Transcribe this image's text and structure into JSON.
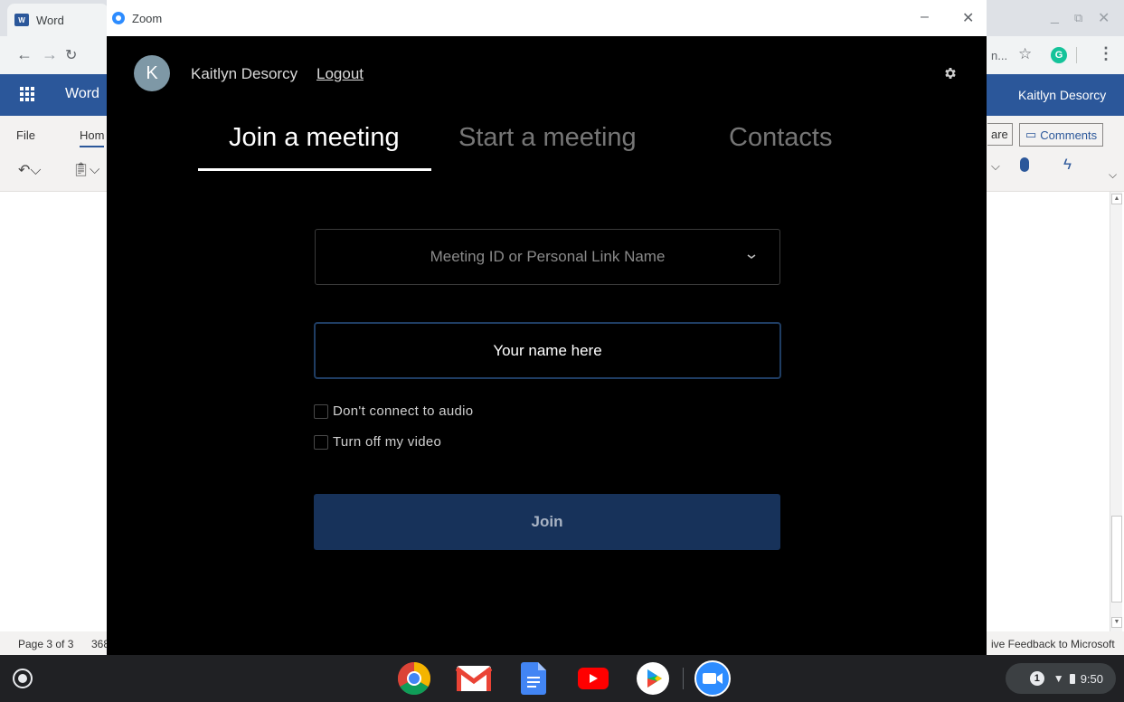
{
  "background_window": {
    "tab_title": "Word",
    "word_app_label": "Word",
    "user_name": "Kaitlyn Desorcy",
    "ribbon_file": "File",
    "ribbon_home": "Hom",
    "share_label": "are",
    "comments_label": "Comments",
    "omnibox_partial": "n...",
    "status_page": "Page 3 of 3",
    "status_words": "368",
    "status_feedback": "ive Feedback to Microsoft"
  },
  "zoom": {
    "window_title": "Zoom",
    "avatar_initial": "K",
    "user_name": "Kaitlyn Desorcy",
    "logout_label": "Logout",
    "tabs": [
      {
        "label": "Join a meeting",
        "active": true
      },
      {
        "label": "Start a meeting",
        "active": false
      },
      {
        "label": "Contacts",
        "active": false
      }
    ],
    "meeting_id_placeholder": "Meeting ID or Personal Link Name",
    "name_placeholder": "Your name here",
    "options": [
      {
        "label": "Don't connect to audio",
        "checked": false
      },
      {
        "label": "Turn off my video",
        "checked": false
      }
    ],
    "join_label": "Join"
  },
  "shelf": {
    "apps": [
      "chrome-icon",
      "gmail-icon",
      "docs-icon",
      "youtube-icon",
      "play-store-icon",
      "zoom-icon"
    ],
    "notification_count": "1",
    "time": "9:50"
  },
  "colors": {
    "zoom_background": "#000000",
    "join_button": "#17325a",
    "input_border": "#1f3d63",
    "word_blue": "#2b579a"
  }
}
